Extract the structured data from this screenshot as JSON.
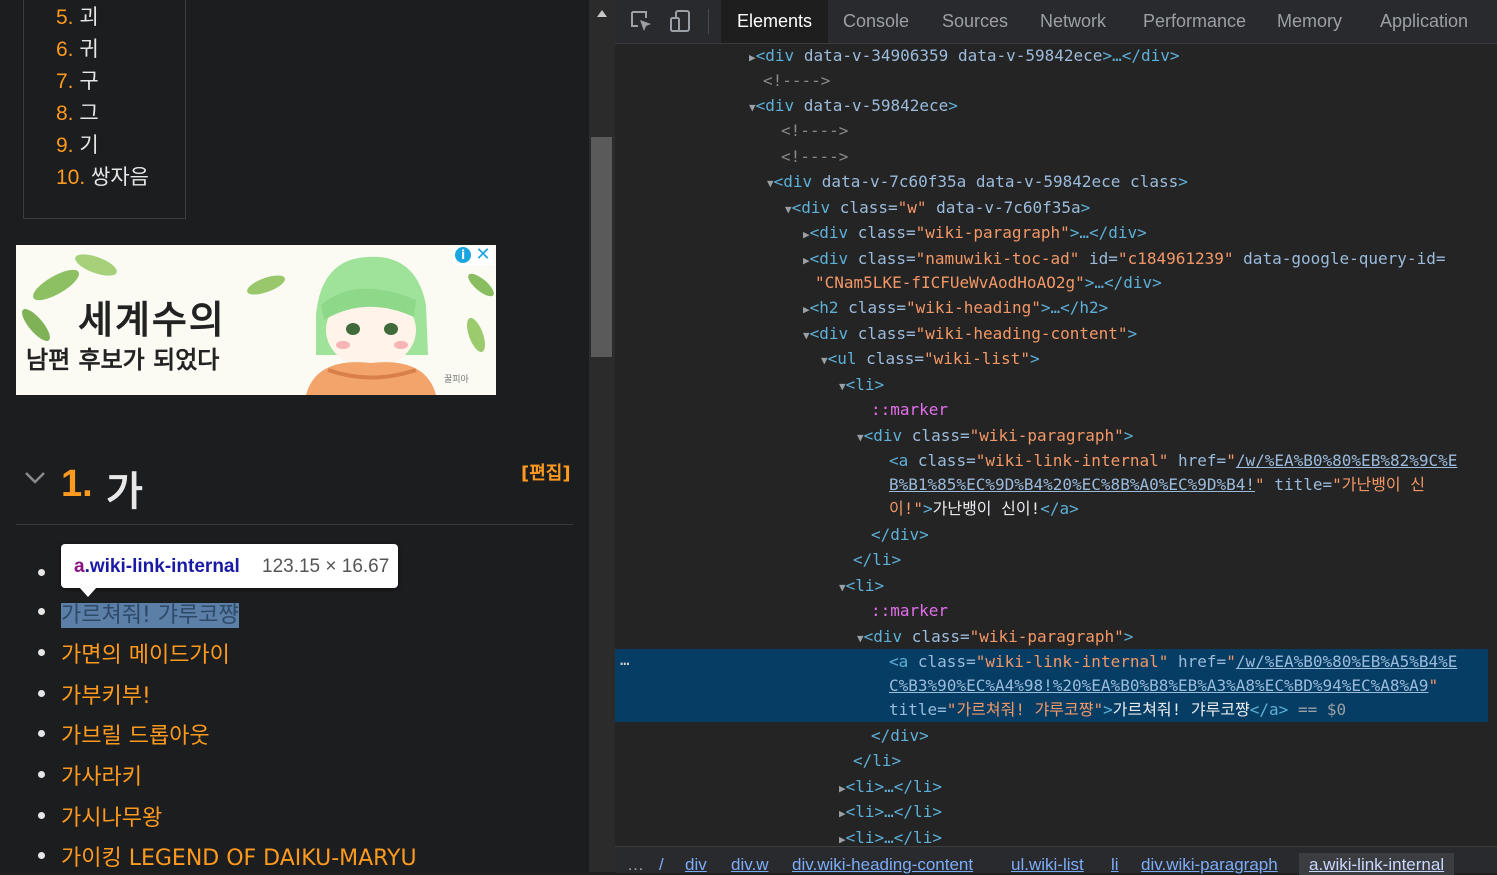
{
  "page": {
    "toc": [
      {
        "num": "5.",
        "label": "괴"
      },
      {
        "num": "6.",
        "label": "귀"
      },
      {
        "num": "7.",
        "label": "구"
      },
      {
        "num": "8.",
        "label": "그"
      },
      {
        "num": "9.",
        "label": "기"
      },
      {
        "num": "10.",
        "label": "쌍자음"
      }
    ],
    "ad": {
      "line1": "세계수의",
      "line2": "남편 후보가 되었다",
      "brand": "꿀피아",
      "info_icon": "i",
      "close_icon": "✕"
    },
    "section": {
      "num": "1.",
      "title": "가",
      "edit": "[편집]"
    },
    "list": [
      "",
      "가르쳐줘! 갸루코쨩",
      "가면의 메이드가이",
      "가부키부!",
      "가브릴 드롭아웃",
      "가사라키",
      "가시나무왕",
      "가이킹 LEGEND OF DAIKU-MARYU"
    ],
    "tooltip": {
      "tag": "a",
      "class": ".wiki-link-internal",
      "size": "123.15 × 16.67"
    }
  },
  "devtools": {
    "tabs": [
      "Elements",
      "Console",
      "Sources",
      "Network",
      "Performance",
      "Memory",
      "Application"
    ],
    "active_tab": "Elements",
    "tree": {
      "r1_tag": "div",
      "r1_attrs": "data-v-34906359 data-v-59842ece",
      "r1_rest": ">…</",
      "r1_close": "div",
      "comment": "<!---->",
      "r3_attrs": "data-v-59842ece",
      "r6_attrs": "data-v-7c60f35a data-v-59842ece class",
      "r7_cls": "w",
      "r7_extra": "data-v-7c60f35a",
      "wiki_paragraph": "wiki-paragraph",
      "toc_ad": "namuwiki-toc-ad",
      "toc_ad_id": "c184961239",
      "toc_ad_q_attr": "data-google-query-id=",
      "toc_ad_q_val": "CNam5LKE-fICFUeWvAodHoAO2g",
      "h2_cls": "wiki-heading",
      "heading_content": "wiki-heading-content",
      "wiki_list": "wiki-list",
      "marker": "::marker",
      "link_cls": "wiki-link-internal",
      "href1a": "/w/%EA%B0%80%EB%82%9C%E",
      "href1b": "B%B1%85%EC%9D%B4%20%EC%8B%A0%EC%9D%B4!",
      "title1a": "가난뱅이 신",
      "title1b": "이!",
      "text1": "가난뱅이 신이!",
      "href2a": "/w/%EA%B0%80%EB%A5%B4%E",
      "href2b": "C%B3%90%EC%A4%98!%20%EA%B0%B8%EB%A3%A8%EC%BD%94%EC%A8%A9",
      "title2": "가르쳐줘! 갸루코쨩",
      "text2": "가르쳐줘! 갸루코쨩",
      "eq": "== $0"
    },
    "breadcrumbs": [
      "…",
      "/",
      "div",
      "div.w",
      "div.wiki-heading-content",
      "ul.wiki-list",
      "li",
      "div.wiki-paragraph",
      "a.wiki-link-internal"
    ]
  }
}
